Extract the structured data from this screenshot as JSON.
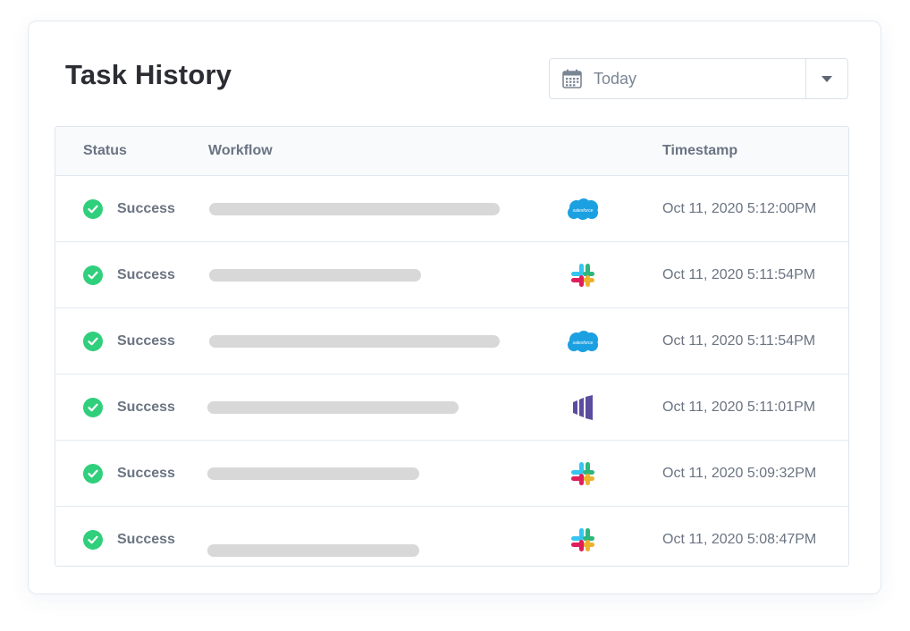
{
  "header": {
    "title": "Task History",
    "date_filter": {
      "value": "Today",
      "icon": "calendar-icon",
      "dropdown_icon": "chevron-down-icon"
    }
  },
  "table": {
    "columns": {
      "status": "Status",
      "workflow": "Workflow",
      "timestamp": "Timestamp"
    },
    "rows": [
      {
        "status": "Success",
        "app": "salesforce",
        "timestamp": "Oct 11, 2020 5:12:00PM"
      },
      {
        "status": "Success",
        "app": "slack",
        "timestamp": "Oct 11, 2020 5:11:54PM"
      },
      {
        "status": "Success",
        "app": "salesforce",
        "timestamp": "Oct 11, 2020 5:11:54PM"
      },
      {
        "status": "Success",
        "app": "marketo",
        "timestamp": "Oct 11, 2020 5:11:01PM"
      },
      {
        "status": "Success",
        "app": "slack",
        "timestamp": "Oct 11, 2020 5:09:32PM"
      },
      {
        "status": "Success",
        "app": "slack",
        "timestamp": "Oct 11, 2020 5:08:47PM"
      }
    ]
  },
  "colors": {
    "success": "#2fcf7c",
    "placeholder_bar": "#d8d8d8",
    "salesforce": "#1ba0e2",
    "marketo": "#5c4c9f",
    "slack_blue": "#36c5f0",
    "slack_green": "#2eb67d",
    "slack_yellow": "#ecb22e",
    "slack_red": "#e01e5a"
  }
}
